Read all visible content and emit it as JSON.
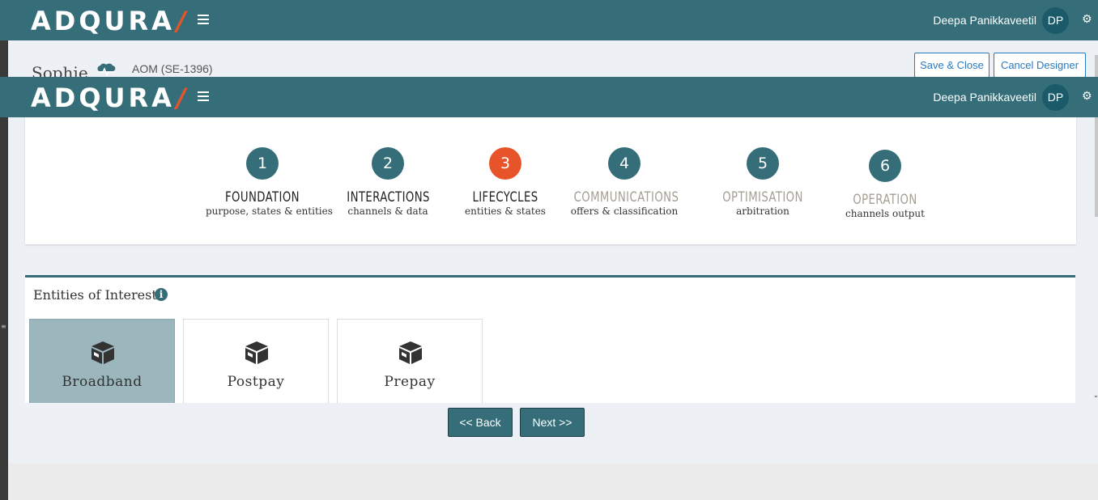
{
  "app": {
    "logo_text": "ADQURA",
    "logo_slash": "/",
    "user_name": "Deepa Panikkaveetil",
    "user_initials": "DP",
    "accent_color": "#356e79",
    "active_color": "#e8542a"
  },
  "header_back": {
    "record_name": "Sophie",
    "record_code": "AOM (SE-1396)",
    "save_close_label": "Save & Close",
    "cancel_label": "Cancel Designer"
  },
  "wizard": {
    "active_step": 3,
    "steps": [
      {
        "num": "1",
        "title": "FOUNDATION",
        "sub": "purpose, states & entities",
        "state": "done"
      },
      {
        "num": "2",
        "title": "INTERACTIONS",
        "sub": "channels & data",
        "state": "done"
      },
      {
        "num": "3",
        "title": "LIFECYCLES",
        "sub": "entities & states",
        "state": "active"
      },
      {
        "num": "4",
        "title": "COMMUNICATIONS",
        "sub": "offers & classification",
        "state": "future"
      },
      {
        "num": "5",
        "title": "OPTIMISATION",
        "sub": "arbitration",
        "state": "future"
      },
      {
        "num": "6",
        "title": "OPERATION",
        "sub": "channels output",
        "state": "future"
      }
    ]
  },
  "entities": {
    "title": "Entities of Interest",
    "info_icon": "info-circle-icon",
    "items": [
      {
        "label": "Broadband",
        "icon": "box-icon",
        "selected": true
      },
      {
        "label": "Postpay",
        "icon": "box-icon",
        "selected": false
      },
      {
        "label": "Prepay",
        "icon": "box-icon",
        "selected": false
      }
    ]
  },
  "nav": {
    "back_label": "<< Back",
    "next_label": "Next >>"
  }
}
